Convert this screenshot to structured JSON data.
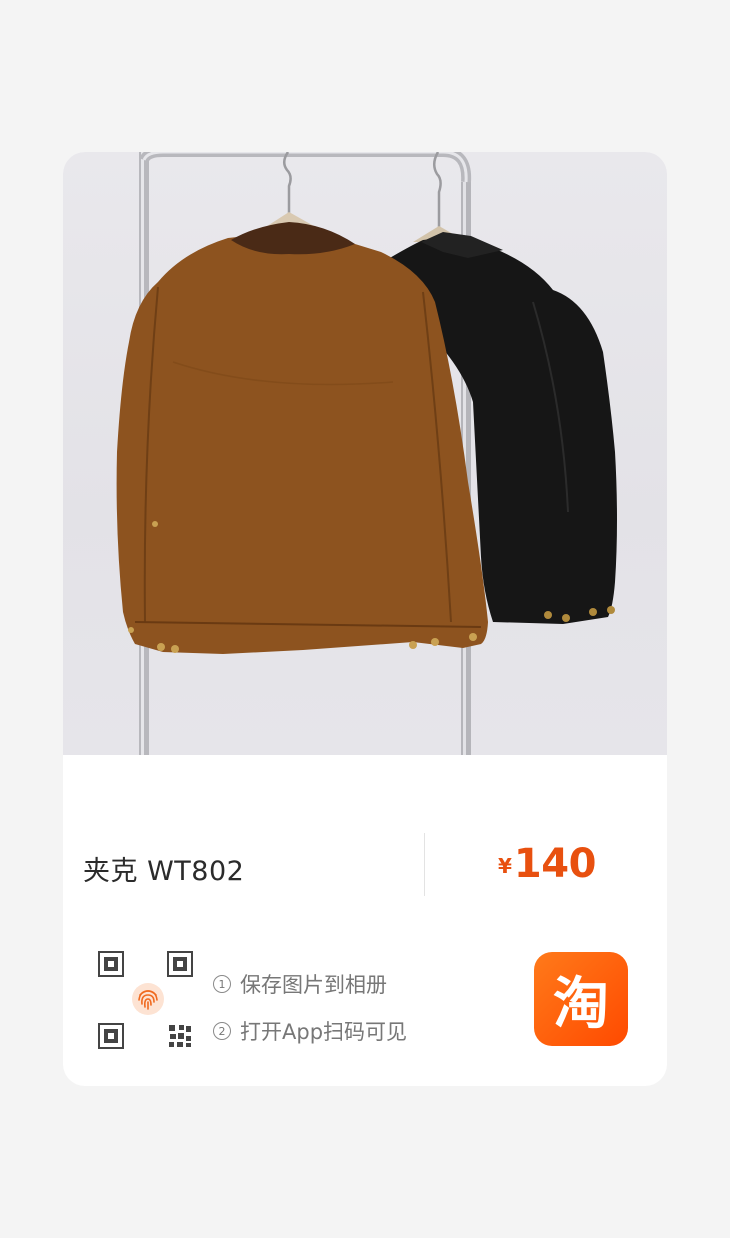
{
  "product": {
    "title": "夹克 WT802",
    "currency": "¥",
    "price": "140"
  },
  "steps": [
    {
      "num": "1",
      "text": "保存图片到相册"
    },
    {
      "num": "2",
      "text": "打开App扫码可见"
    }
  ],
  "app_icon": {
    "glyph": "淘",
    "name": "taobao-icon",
    "color": "#ff5000"
  },
  "colors": {
    "price": "#e8500f",
    "brown_jacket": "#8d531f",
    "black_jacket": "#161616"
  }
}
